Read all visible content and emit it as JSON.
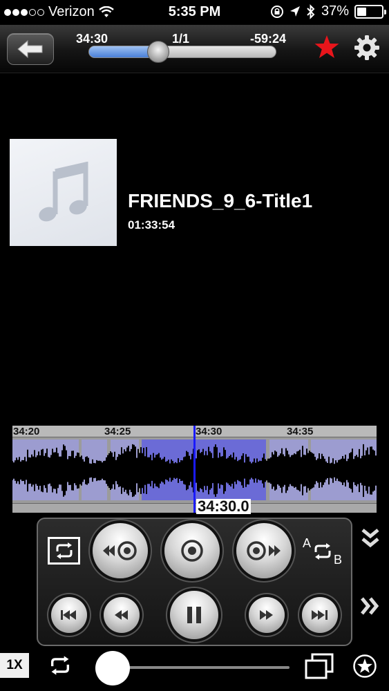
{
  "status_bar": {
    "carrier": "Verizon",
    "time": "5:35 PM",
    "battery": "37%",
    "battery_level": 0.37,
    "signal_bars": 3
  },
  "toolbar": {
    "elapsed": "34:30",
    "track_index": "1/1",
    "remaining": "-59:24",
    "progress": 0.37,
    "back_icon": "back-arrow-icon",
    "favorite_icon": "star-icon",
    "settings_icon": "gear-icon",
    "accent": "#4a80d8",
    "favorite_color": "#e8151b"
  },
  "now_playing": {
    "title": "FRIENDS_9_6-Title1",
    "duration": "01:33:54",
    "artwork_icon": "music-note-icon"
  },
  "waveform": {
    "ticks": [
      "34:20",
      "34:25",
      "34:30",
      "34:35"
    ],
    "current_time": "34:30.0",
    "highlight_color": "#6b6bd6",
    "playhead_color": "#1a1aff"
  },
  "controls": {
    "loop_icon": "loop-icon",
    "ab_repeat": {
      "a": "A",
      "b": "B"
    },
    "buttons": [
      "skip-back-icon",
      "target-icon",
      "skip-forward-icon",
      "previous-track-icon",
      "rewind-icon",
      "pause-icon",
      "fast-forward-icon",
      "next-track-icon"
    ],
    "collapse_icon": "double-chevron-down-icon",
    "expand_icon": "double-chevron-right-icon"
  },
  "bottom_bar": {
    "speed": "1X",
    "repeat_icon": "repeat-icon",
    "volume": 0.0,
    "window_icon": "windows-icon",
    "favorites_icon": "star-circle-icon"
  }
}
